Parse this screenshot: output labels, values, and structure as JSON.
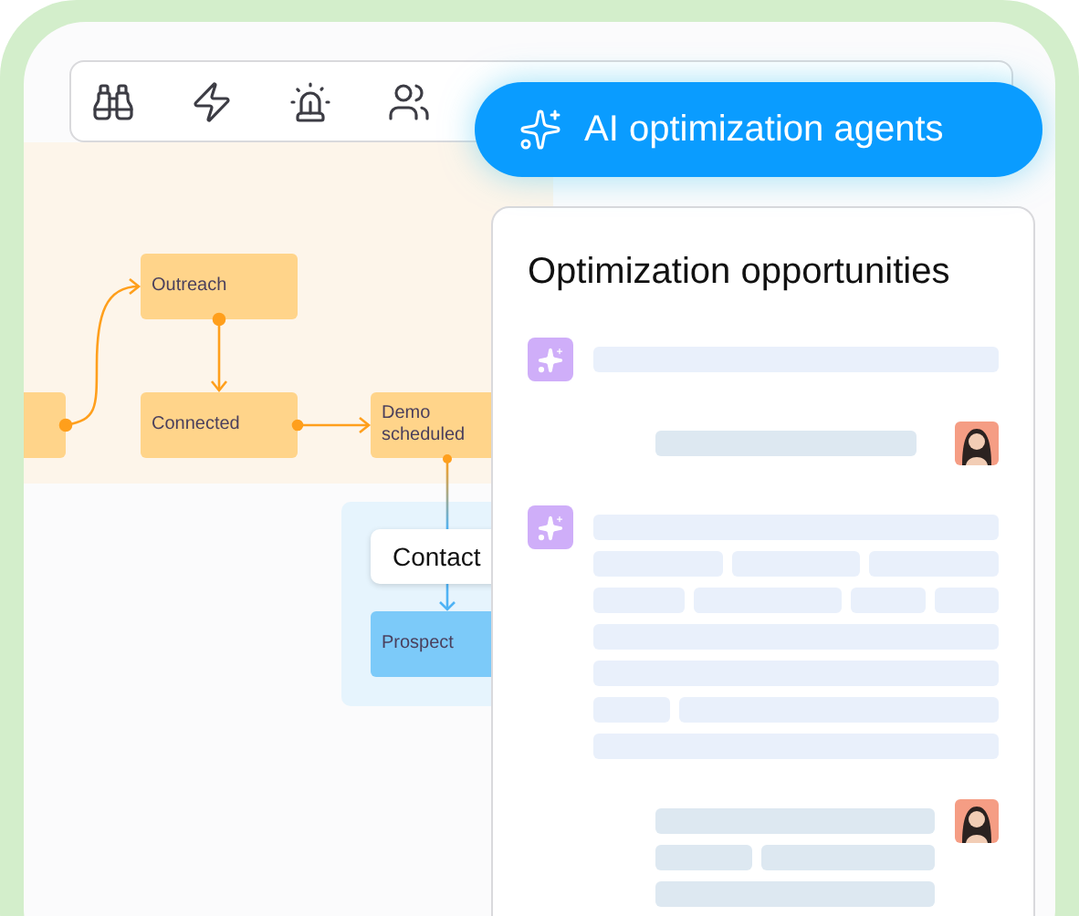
{
  "toolbar": {
    "agents_button": {
      "label": "AI optimization agents"
    }
  },
  "diagram": {
    "nodes": [
      {
        "kind": "stage",
        "label": "Outreach"
      },
      {
        "kind": "stage",
        "label": "Connected"
      },
      {
        "kind": "stage",
        "label": "Demo scheduled"
      },
      {
        "kind": "lead",
        "label": "Prospect"
      }
    ],
    "group_label": "Contact"
  },
  "panel": {
    "title": "Optimization opportunities",
    "messages": [
      {
        "kind": "agent"
      },
      {
        "kind": "user"
      },
      {
        "kind": "agent"
      },
      {
        "kind": "user"
      }
    ]
  }
}
